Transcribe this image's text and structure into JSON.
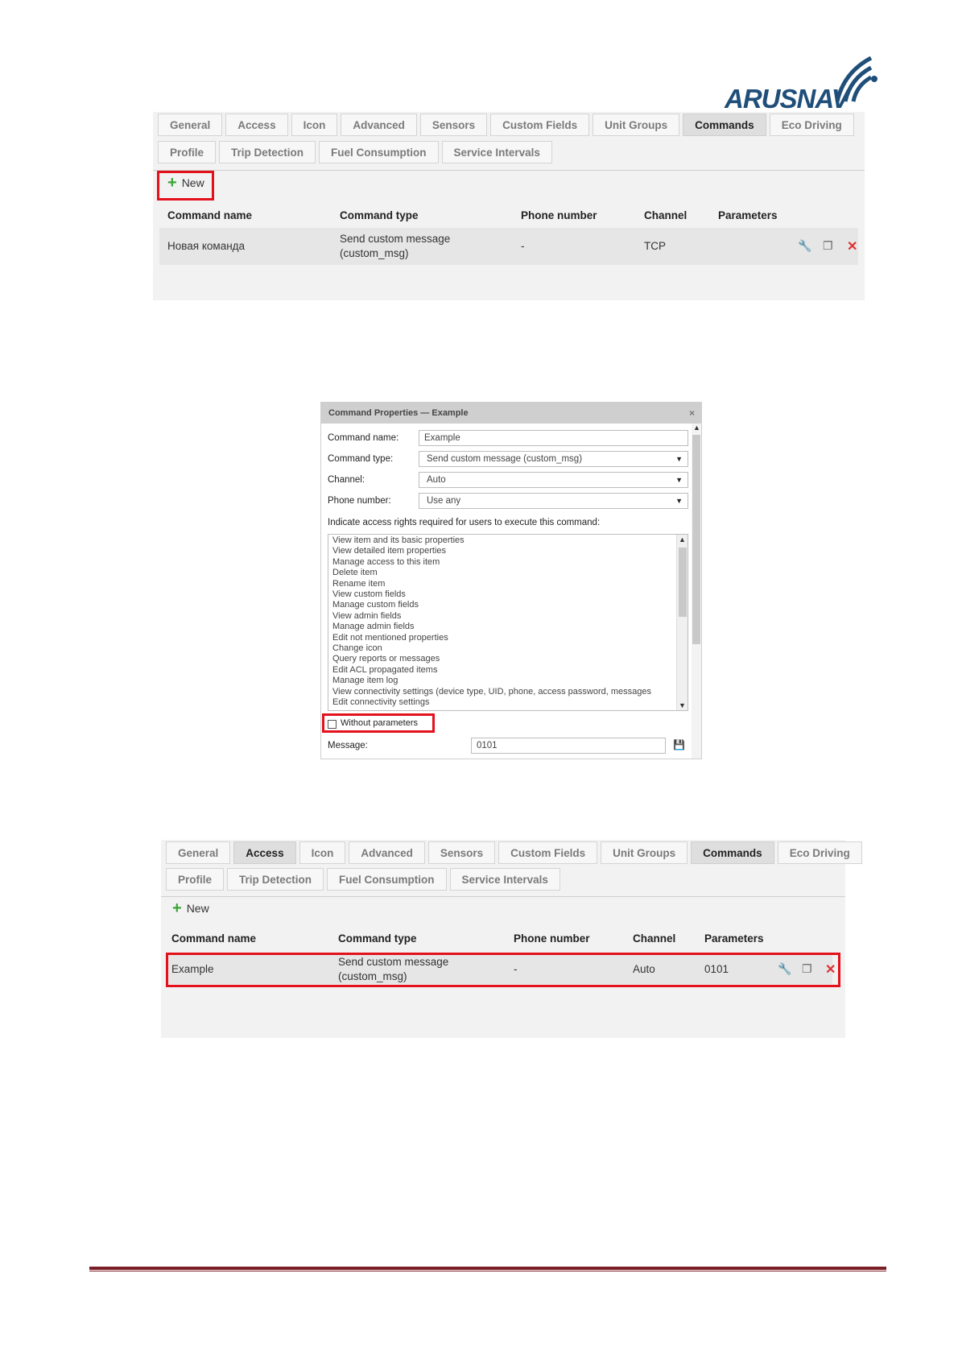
{
  "logo": {
    "text_a": "ARUS",
    "text_b": "NAV"
  },
  "tabs": [
    "General",
    "Access",
    "Icon",
    "Advanced",
    "Sensors",
    "Custom Fields",
    "Unit Groups",
    "Commands",
    "Eco Driving"
  ],
  "tabs_row2": [
    "Profile",
    "Trip Detection",
    "Fuel Consumption",
    "Service Intervals"
  ],
  "new_label": "New",
  "columns": [
    "Command name",
    "Command type",
    "Phone number",
    "Channel",
    "Parameters"
  ],
  "panel1": {
    "active_tab": "Commands",
    "row": {
      "name": "Новая команда",
      "type_line1": "Send custom message",
      "type_line2": "(custom_msg)",
      "phone": "-",
      "channel": "TCP",
      "params": ""
    }
  },
  "dialog": {
    "title": "Command Properties — Example",
    "close": "×",
    "name_label": "Command name:",
    "name_value": "Example",
    "type_label": "Command type:",
    "type_value": "Send custom message (custom_msg)",
    "channel_label": "Channel:",
    "channel_value": "Auto",
    "phone_label": "Phone number:",
    "phone_value": "Use any",
    "rights_label": "Indicate access rights required for users to execute this command:",
    "rights": [
      "View item and its basic properties",
      "View detailed item properties",
      "Manage access to this item",
      "Delete item",
      "Rename item",
      "View custom fields",
      "Manage custom fields",
      "View admin fields",
      "Manage admin fields",
      "Edit not mentioned properties",
      "Change icon",
      "Query reports or messages",
      "Edit ACL propagated items",
      "Manage item log",
      "View connectivity settings (device type, UID, phone, access password, messages",
      "Edit connectivity settings"
    ],
    "without_params": "Without parameters",
    "message_label": "Message:",
    "message_value": "0101"
  },
  "panel2": {
    "active_tabs": [
      "Access",
      "Commands"
    ],
    "row": {
      "name": "Example",
      "type_line1": "Send custom message",
      "type_line2": "(custom_msg)",
      "phone": "-",
      "channel": "Auto",
      "params": "0101"
    }
  },
  "colors": {
    "highlight": "#e3111b",
    "brand": "#1f4e79",
    "footer": "#7b1f26",
    "plus": "#3aa635"
  }
}
